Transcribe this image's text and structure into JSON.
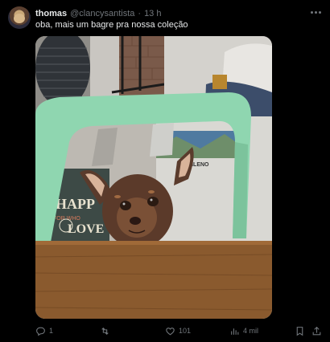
{
  "post": {
    "author_name": "thomas",
    "handle": "@clancysantista",
    "separator": "·",
    "time": "13 h",
    "text": "oba, mais um bagre pra nossa coleção"
  },
  "media": {
    "description_icons": [
      "fan-icon",
      "chair-icon",
      "dog-icon",
      "table-icon"
    ],
    "bag_text": [
      "HAPP",
      "FOR WHO",
      "LOVE",
      "ANILENO"
    ]
  },
  "actions": {
    "reply_count": "1",
    "repost_count": "",
    "like_count": "101",
    "view_count": "4 mil"
  },
  "colors": {
    "background": "#000000",
    "text_primary": "#e7e9ea",
    "text_secondary": "#71767b",
    "chair": "#8fd6b0",
    "table": "#8a5a2e"
  }
}
